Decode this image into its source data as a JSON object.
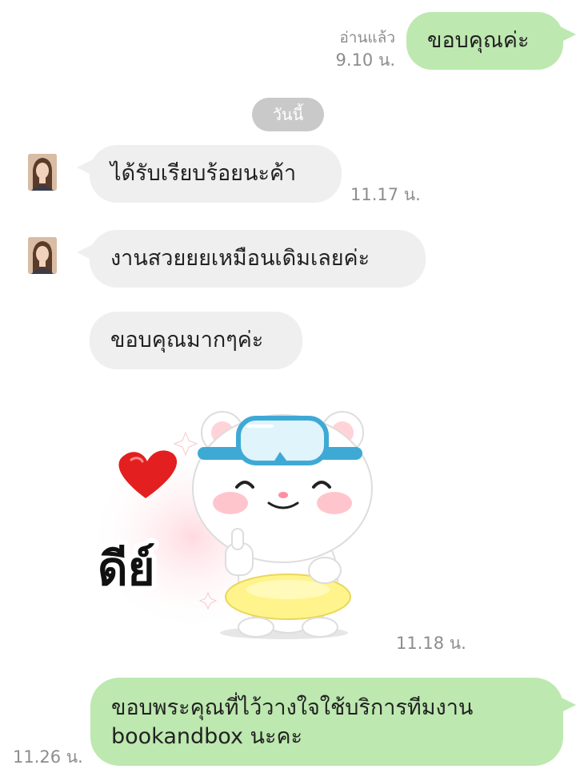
{
  "messages": [
    {
      "id": "m1",
      "direction": "outgoing",
      "text": "ขอบคุณค่ะ",
      "read_status": "อ่านแล้ว",
      "time": "9.10 น."
    },
    {
      "id": "m2",
      "direction": "incoming",
      "text": "ได้รับเรียบร้อยนะค้า",
      "time": "11.17 น."
    },
    {
      "id": "m3",
      "direction": "incoming",
      "text": "งานสวยยยเหมือนเดิมเลยค่ะ"
    },
    {
      "id": "m4",
      "direction": "incoming",
      "text": "ขอบคุณมากๆค่ะ"
    },
    {
      "id": "m5",
      "direction": "incoming",
      "type": "sticker",
      "sticker_text": "ดีย์",
      "time": "11.18 น."
    },
    {
      "id": "m6",
      "direction": "outgoing",
      "text_line1": "ขอบพระคุณที่ไว้วางใจใช้บริการทีมงาน",
      "text_line2": "bookandbox นะคะ",
      "time": "11.26 น."
    }
  ],
  "date_separator": "วันนี้",
  "colors": {
    "outgoing_bubble": "#bde8b0",
    "incoming_bubble": "#efefef",
    "meta_text": "#8d8d8d",
    "date_chip": "#c9c9c9"
  },
  "icons": {
    "avatar": "contact-avatar-photo",
    "sticker": "white-bear-thumbs-up-sticker"
  }
}
